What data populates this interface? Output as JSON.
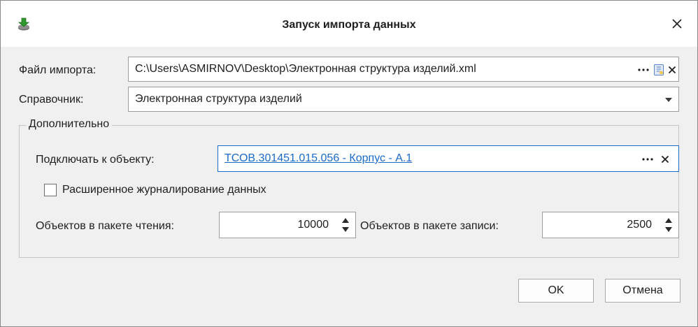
{
  "window": {
    "title": "Запуск импорта данных",
    "app_icon": "import-data-icon",
    "close_icon": "close-icon"
  },
  "import_file": {
    "label": "Файл импорта:",
    "value": "C:\\Users\\ASMIRNOV\\Desktop\\Электронная структура изделий.xml",
    "browse_icon": "ellipsis-icon",
    "file_icon": "file-icon",
    "clear_icon": "clear-icon"
  },
  "reference": {
    "label": "Справочник:",
    "value": "Электронная структура изделий",
    "dropdown_icon": "chevron-down-icon"
  },
  "additional": {
    "legend": "Дополнительно",
    "connect_label": "Подключать к объекту:",
    "connect_value": "ТСОВ.301451.015.056 - Корпус - А.1",
    "extended_logging_label": "Расширенное журналирование данных",
    "extended_logging_checked": false,
    "read_batch_label": "Объектов в пакете чтения:",
    "read_batch_value": "10000",
    "write_batch_label": "Объектов в пакете записи:",
    "write_batch_value": "2500"
  },
  "buttons": {
    "ok": "OK",
    "cancel": "Отмена"
  },
  "colors": {
    "link": "#1a6bc7",
    "focus_border": "#1a6bc7",
    "background": "#f0f0f0"
  }
}
